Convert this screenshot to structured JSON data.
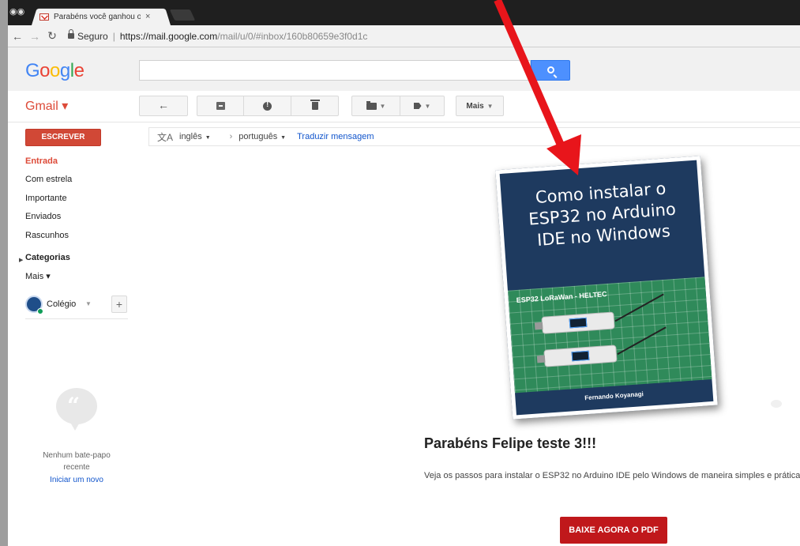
{
  "browser": {
    "tab_title": "Parabéns você ganhou o",
    "tab_close": "×",
    "secure_label": "Seguro",
    "url_main": "https://mail.google.com",
    "url_rest": "/mail/u/0/#inbox/160b80659e3f0d1c"
  },
  "header": {
    "logo_letters": [
      "G",
      "o",
      "o",
      "g",
      "l",
      "e"
    ],
    "logo_colors": [
      "#4285f4",
      "#ea4335",
      "#fbbc05",
      "#4285f4",
      "#34a853",
      "#ea4335"
    ],
    "search_placeholder": ""
  },
  "gmail_bar": {
    "label": "Gmail ▾",
    "more_label": "Mais"
  },
  "sidebar": {
    "compose": "ESCREVER",
    "items": [
      {
        "label": "Entrada"
      },
      {
        "label": "Com estrela"
      },
      {
        "label": "Importante"
      },
      {
        "label": "Enviados"
      },
      {
        "label": "Rascunhos"
      },
      {
        "label": "Categorias"
      },
      {
        "label": "Mais ▾"
      }
    ],
    "account": "Colégio",
    "chat": {
      "line1": "Nenhum bate-papo",
      "line2": "recente",
      "link": "Iniciar um novo"
    }
  },
  "translate": {
    "from": "inglês",
    "to": "português",
    "link": "Traduzir mensagem"
  },
  "email": {
    "book_title": "Como instalar o ESP32 no Arduino IDE no Windows",
    "photo_caption": "ESP32 LoRaWan - HELTEC",
    "book_author": "Fernando Koyanagi",
    "heading": "Parabéns Felipe teste 3!!!",
    "body": "Veja os passos para instalar o ESP32 no Arduino IDE pelo Windows de maneira simples e prática.",
    "cta": "BAIXE AGORA O PDF"
  },
  "colors": {
    "annotation_arrow": "#e8151b",
    "compose": "#d14836",
    "cta": "#c0181b"
  }
}
